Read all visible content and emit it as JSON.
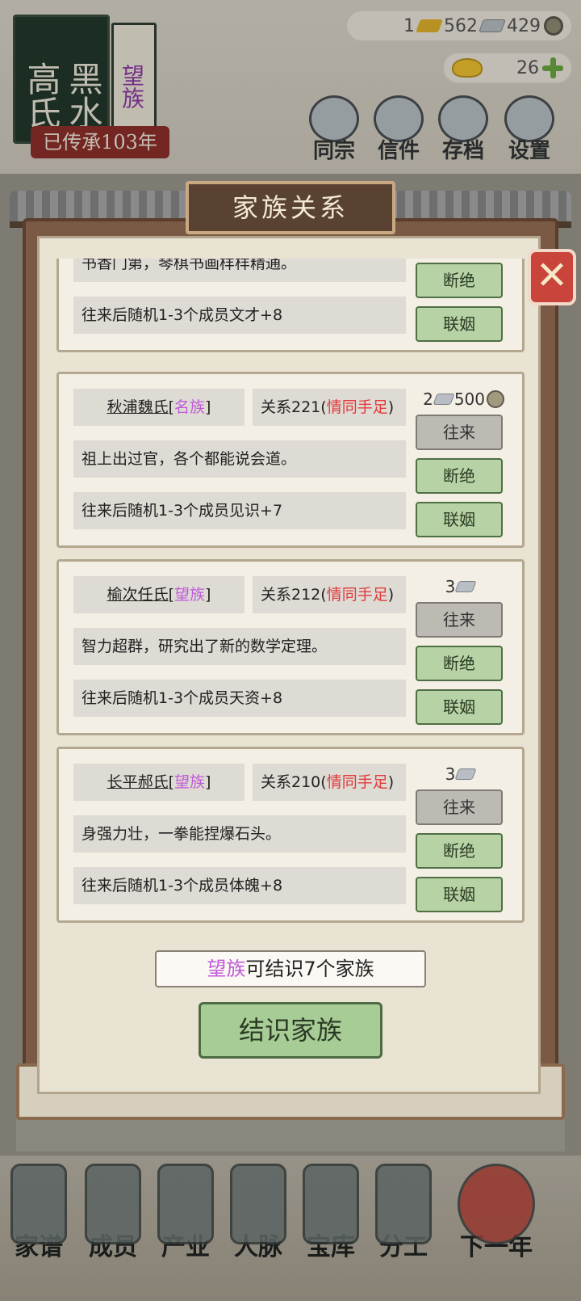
{
  "family": {
    "name_line1": "黑水",
    "name_line2": "高氏",
    "rank_tag": "望族",
    "inherit_label": "已传承103年"
  },
  "resources": {
    "gold": "1",
    "silver": "562",
    "coins": "429",
    "ingots": "26"
  },
  "top_nav": [
    {
      "label": "同宗",
      "icon": "books-icon"
    },
    {
      "label": "信件",
      "icon": "letters-icon"
    },
    {
      "label": "存档",
      "icon": "scroll-icon"
    },
    {
      "label": "设置",
      "icon": "gear-icon"
    }
  ],
  "dialog": {
    "title": "家族关系",
    "close_icon": "close-x-icon",
    "partial_card": {
      "desc": "书香门第，琴棋书画样样精通。",
      "bonus": "往来后随机1-3个成员文才+8",
      "btn_break": "断绝",
      "btn_marry": "联姻"
    },
    "cards": [
      {
        "name": "秋浦魏氏",
        "rank": "名族",
        "relation_prefix": "关系221(",
        "relation_status": "情同手足",
        "relation_suffix": ")",
        "cost_silver": "2",
        "cost_coins": "500",
        "desc": "祖上出过官，各个都能说会道。",
        "bonus": "往来后随机1-3个成员见识+7",
        "btn_visit": "往来",
        "btn_break": "断绝",
        "btn_marry": "联姻"
      },
      {
        "name": "榆次任氏",
        "rank": "望族",
        "relation_prefix": "关系212(",
        "relation_status": "情同手足",
        "relation_suffix": ")",
        "cost_silver": "3",
        "desc": "智力超群，研究出了新的数学定理。",
        "bonus": "往来后随机1-3个成员天资+8",
        "btn_visit": "往来",
        "btn_break": "断绝",
        "btn_marry": "联姻"
      },
      {
        "name": "长平郝氏",
        "rank": "望族",
        "relation_prefix": "关系210(",
        "relation_status": "情同手足",
        "relation_suffix": ")",
        "cost_silver": "3",
        "desc": "身强力壮，一拳能捏爆石头。",
        "bonus": "往来后随机1-3个成员体魄+8",
        "btn_visit": "往来",
        "btn_break": "断绝",
        "btn_marry": "联姻"
      }
    ],
    "info_rank": "望族",
    "info_text": "可结识7个家族",
    "main_button": "结识家族"
  },
  "bottom_nav": [
    {
      "label": "家谱",
      "icon": "genealogy-icon"
    },
    {
      "label": "成员",
      "icon": "member-icon"
    },
    {
      "label": "产业",
      "icon": "building-icon"
    },
    {
      "label": "人脉",
      "icon": "network-icon"
    },
    {
      "label": "宝库",
      "icon": "treasure-chest-icon"
    },
    {
      "label": "分工",
      "icon": "scroll-tasks-icon"
    },
    {
      "label": "下一年",
      "icon": "lantern-icon"
    }
  ],
  "colors": {
    "rank_purple": "#c05ad8",
    "status_red": "#e23b3b",
    "button_green": "#b7d2a4",
    "button_gray": "#bdbab4"
  }
}
